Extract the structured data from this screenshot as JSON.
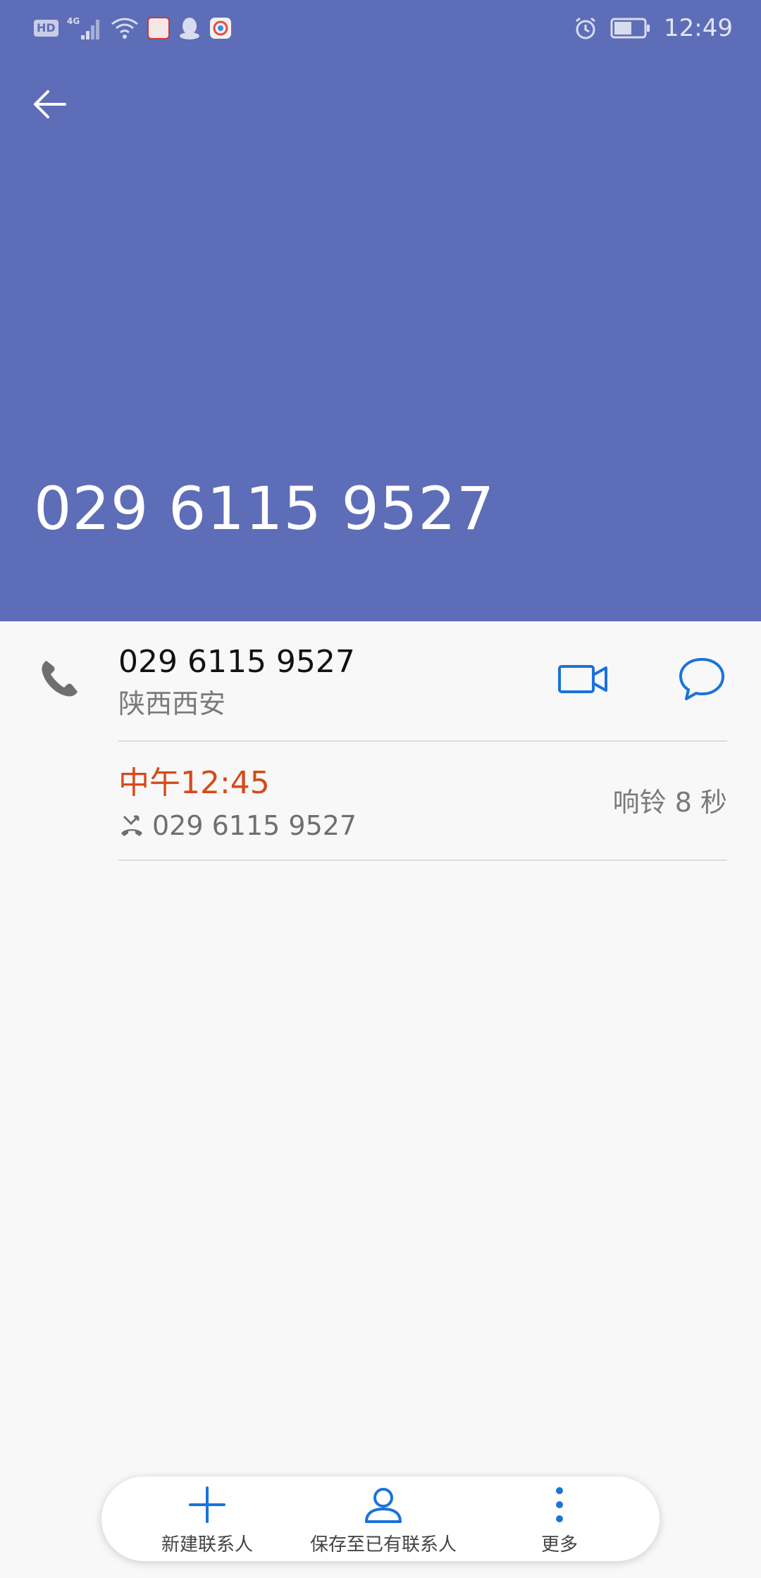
{
  "status_bar": {
    "left_icons": [
      "hd-badge",
      "signal-4g-icon",
      "wifi-icon",
      "app-icon-red",
      "qq-icon",
      "camera-app-icon"
    ],
    "hd_label": "HD",
    "time": "12:49",
    "right_icons": [
      "alarm-icon",
      "battery-icon"
    ]
  },
  "header": {
    "background_color": "#5e6db7",
    "back_icon": "arrow-left-icon",
    "number": "029 6115 9527"
  },
  "contact": {
    "number": "029 6115 9527",
    "location": "陕西西安",
    "call_icon": "phone-icon",
    "video_icon": "video-call-icon",
    "message_icon": "message-icon"
  },
  "call_log": [
    {
      "time": "中午12:45",
      "type_icon": "missed-call-icon",
      "number": "029 6115 9527",
      "duration": "响铃 8 秒",
      "time_color": "#d64a1a"
    }
  ],
  "bottom_bar": {
    "items": [
      {
        "label": "新建联系人",
        "icon": "plus-icon"
      },
      {
        "label": "保存至已有联系人",
        "icon": "person-icon"
      },
      {
        "label": "更多",
        "icon": "more-vertical-icon"
      }
    ],
    "accent_color": "#1a73d9"
  }
}
